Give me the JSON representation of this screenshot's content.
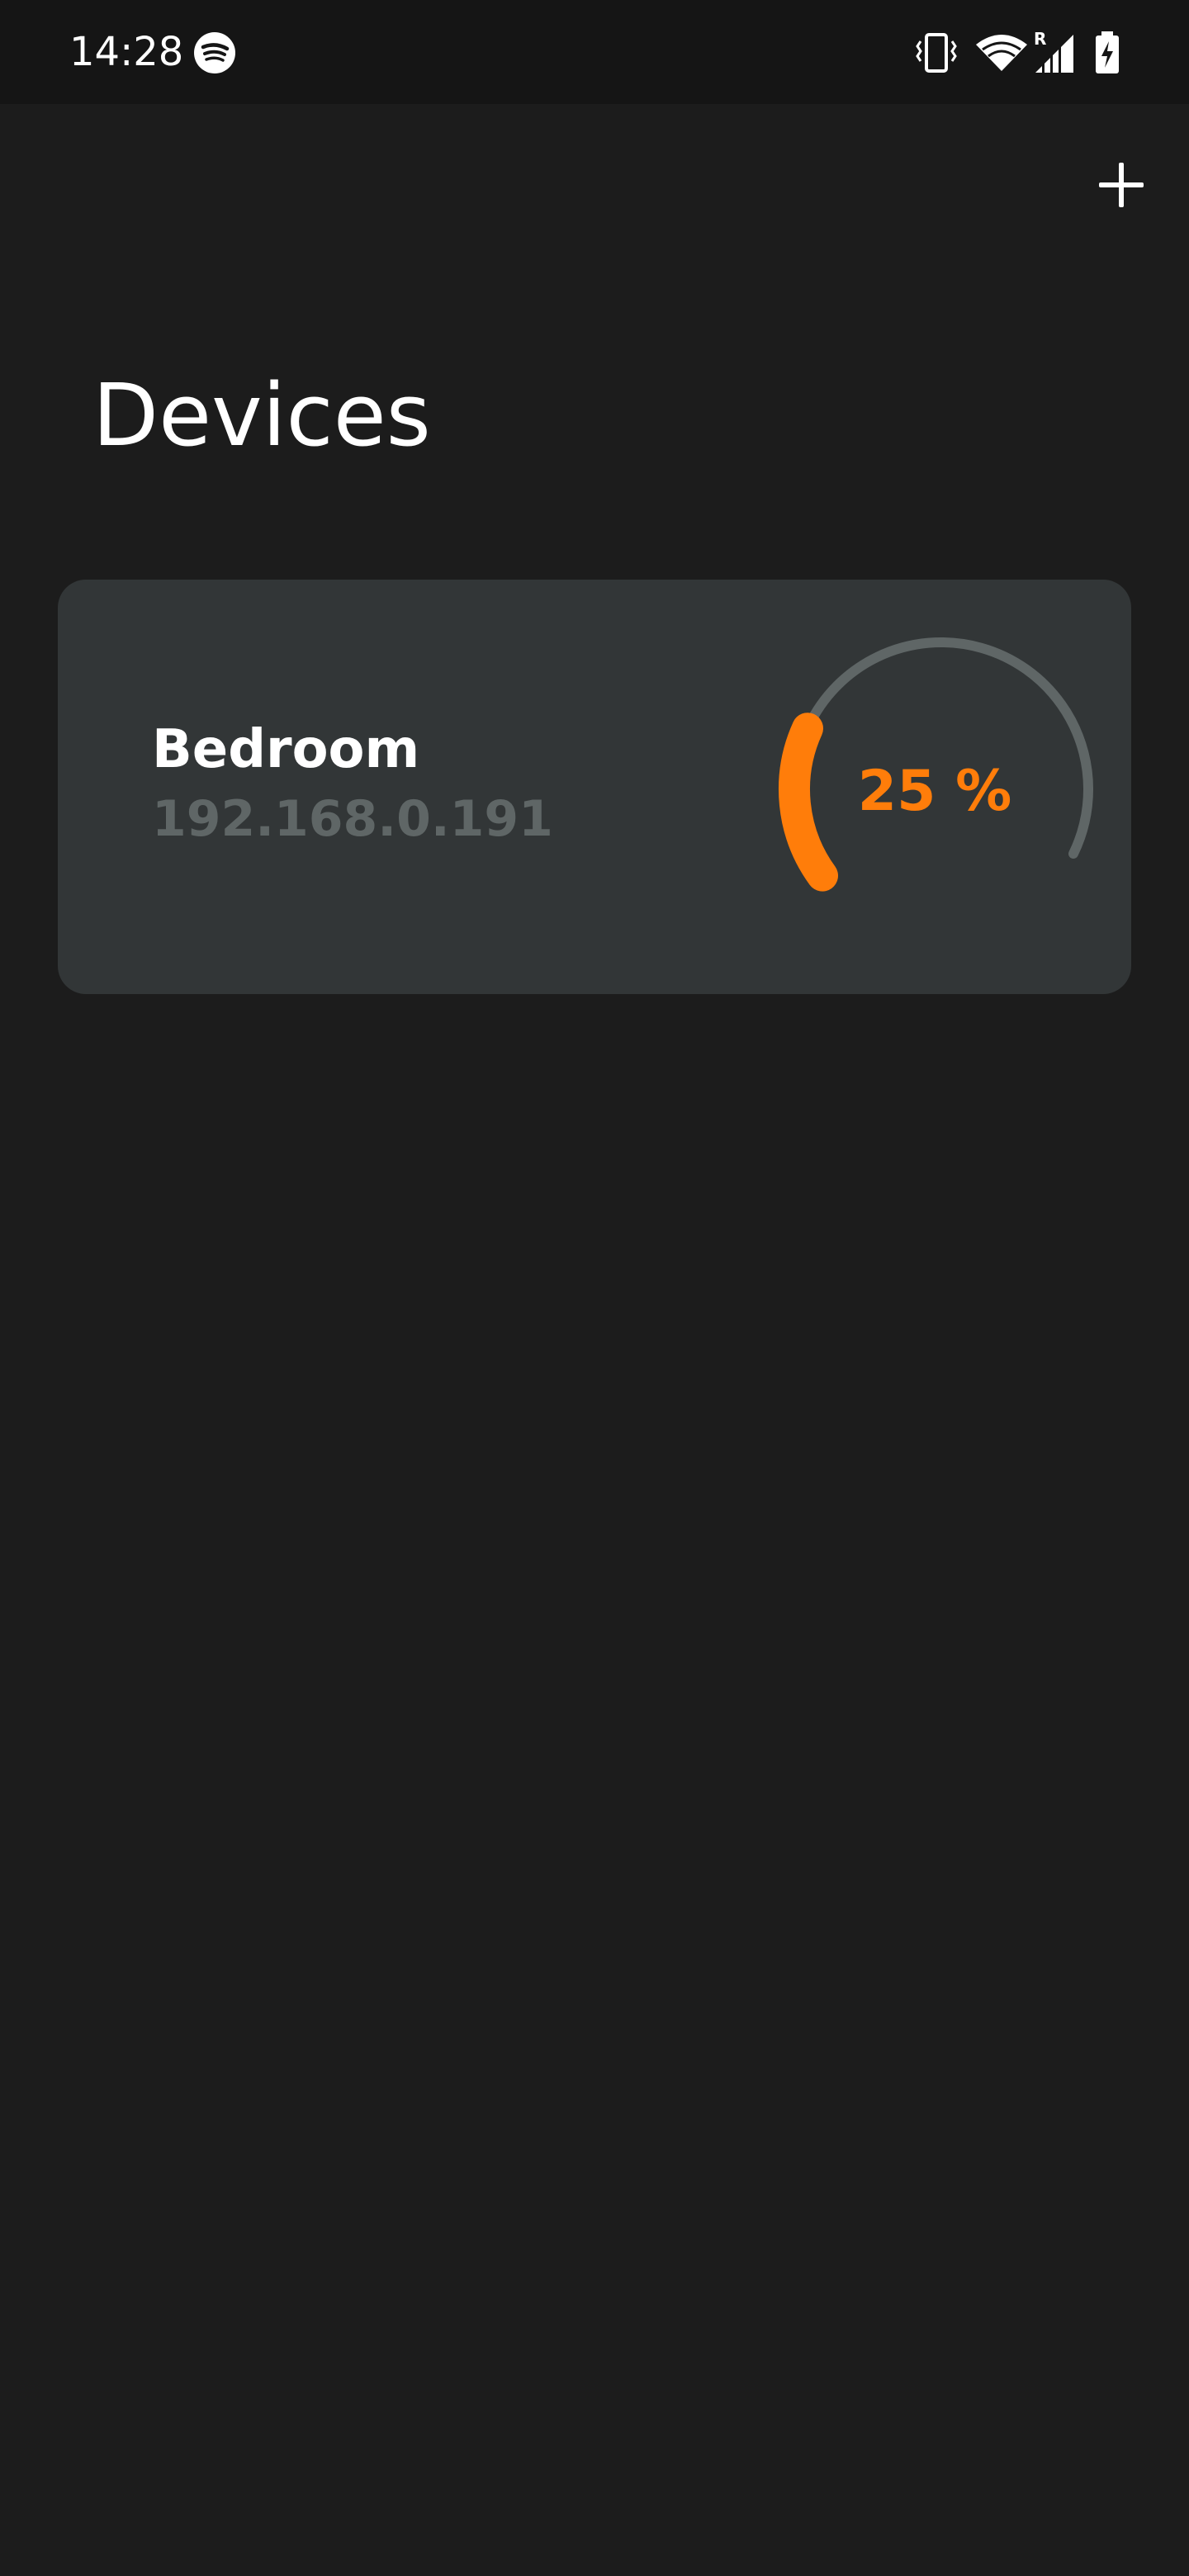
{
  "status_bar": {
    "time": "14:28",
    "icons": [
      "spotify-icon",
      "vibrate-icon",
      "wifi-icon",
      "roaming-signal-icon",
      "battery-charging-icon"
    ],
    "roaming_label": "R"
  },
  "header": {
    "add_icon": "plus-icon"
  },
  "page": {
    "title": "Devices"
  },
  "devices": [
    {
      "name": "Bedroom",
      "ip": "192.168.0.191",
      "level_percent": 25,
      "level_label": "25 %"
    }
  ],
  "colors": {
    "background": "#1c1c1c",
    "status_bar": "#151515",
    "card": "#323637",
    "accent": "#ff7d0a",
    "gauge_track": "#5f6666",
    "muted_text": "#5f6666"
  }
}
